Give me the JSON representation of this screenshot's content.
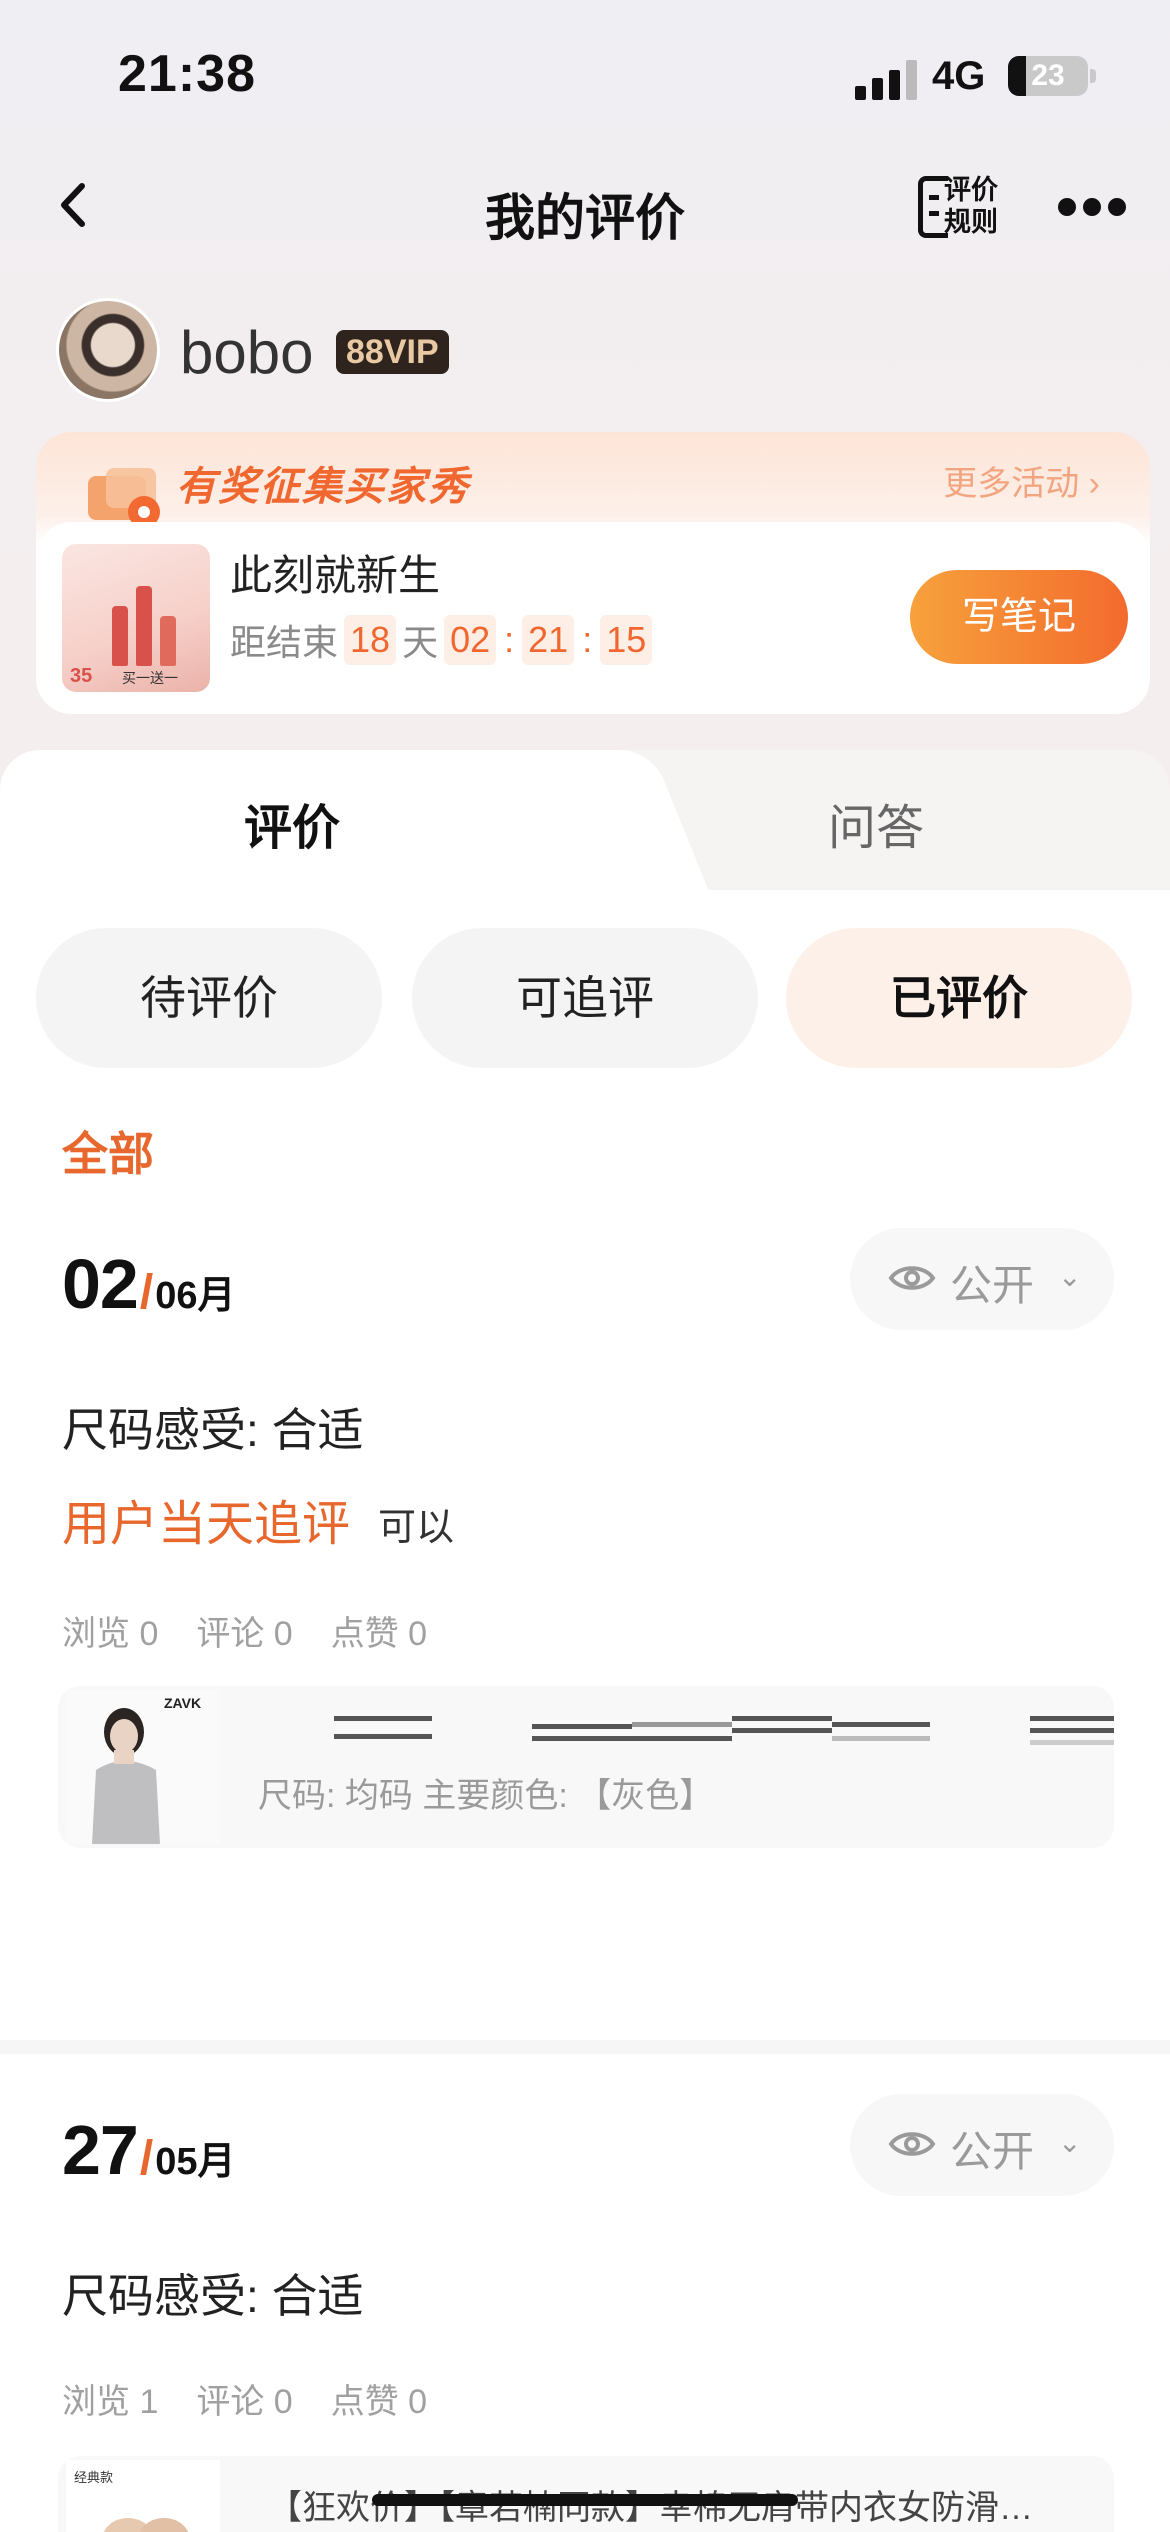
{
  "status_bar": {
    "time": "21:38",
    "network": "4G",
    "battery": "23",
    "battery_fraction": 0.23
  },
  "nav": {
    "title": "我的评价",
    "rules_label": "评价规则"
  },
  "profile": {
    "username": "bobo",
    "badge": "88VIP"
  },
  "activity": {
    "banner_title": "有奖征集买家秀",
    "more_label": "更多活动",
    "name": "此刻就新生",
    "countdown_prefix": "距结束",
    "days": "18",
    "days_unit": "天",
    "hours": "02",
    "minutes": "21",
    "seconds": "15",
    "thumb_price": "35",
    "thumb_promo": "买一送一",
    "button": "写笔记"
  },
  "tabs": [
    {
      "label": "评价",
      "active": true
    },
    {
      "label": "问答",
      "active": false
    }
  ],
  "filters": [
    {
      "label": "待评价"
    },
    {
      "label": "可追评"
    },
    {
      "label": "已评价",
      "active": true
    }
  ],
  "category": "全部",
  "reviews": [
    {
      "day": "02",
      "month": "06月",
      "visibility": "公开",
      "size_feel": "尺码感受: 合适",
      "followup_tag": "用户当天追评",
      "followup_text": "可以",
      "stats": {
        "views": "浏览 0",
        "comments": "评论 0",
        "likes": "点赞 0"
      },
      "product": {
        "brand": "ZAVK",
        "spec": "尺码: 均码 主要颜色: 【灰色】"
      }
    },
    {
      "day": "27",
      "month": "05月",
      "visibility": "公开",
      "size_feel": "尺码感受: 合适",
      "stats": {
        "views": "浏览 1",
        "comments": "评论 0",
        "likes": "点赞 0"
      },
      "product": {
        "label": "经典款",
        "name": "【狂欢价】【章若楠同款】幸棉无肩带内衣女防滑…"
      }
    }
  ]
}
